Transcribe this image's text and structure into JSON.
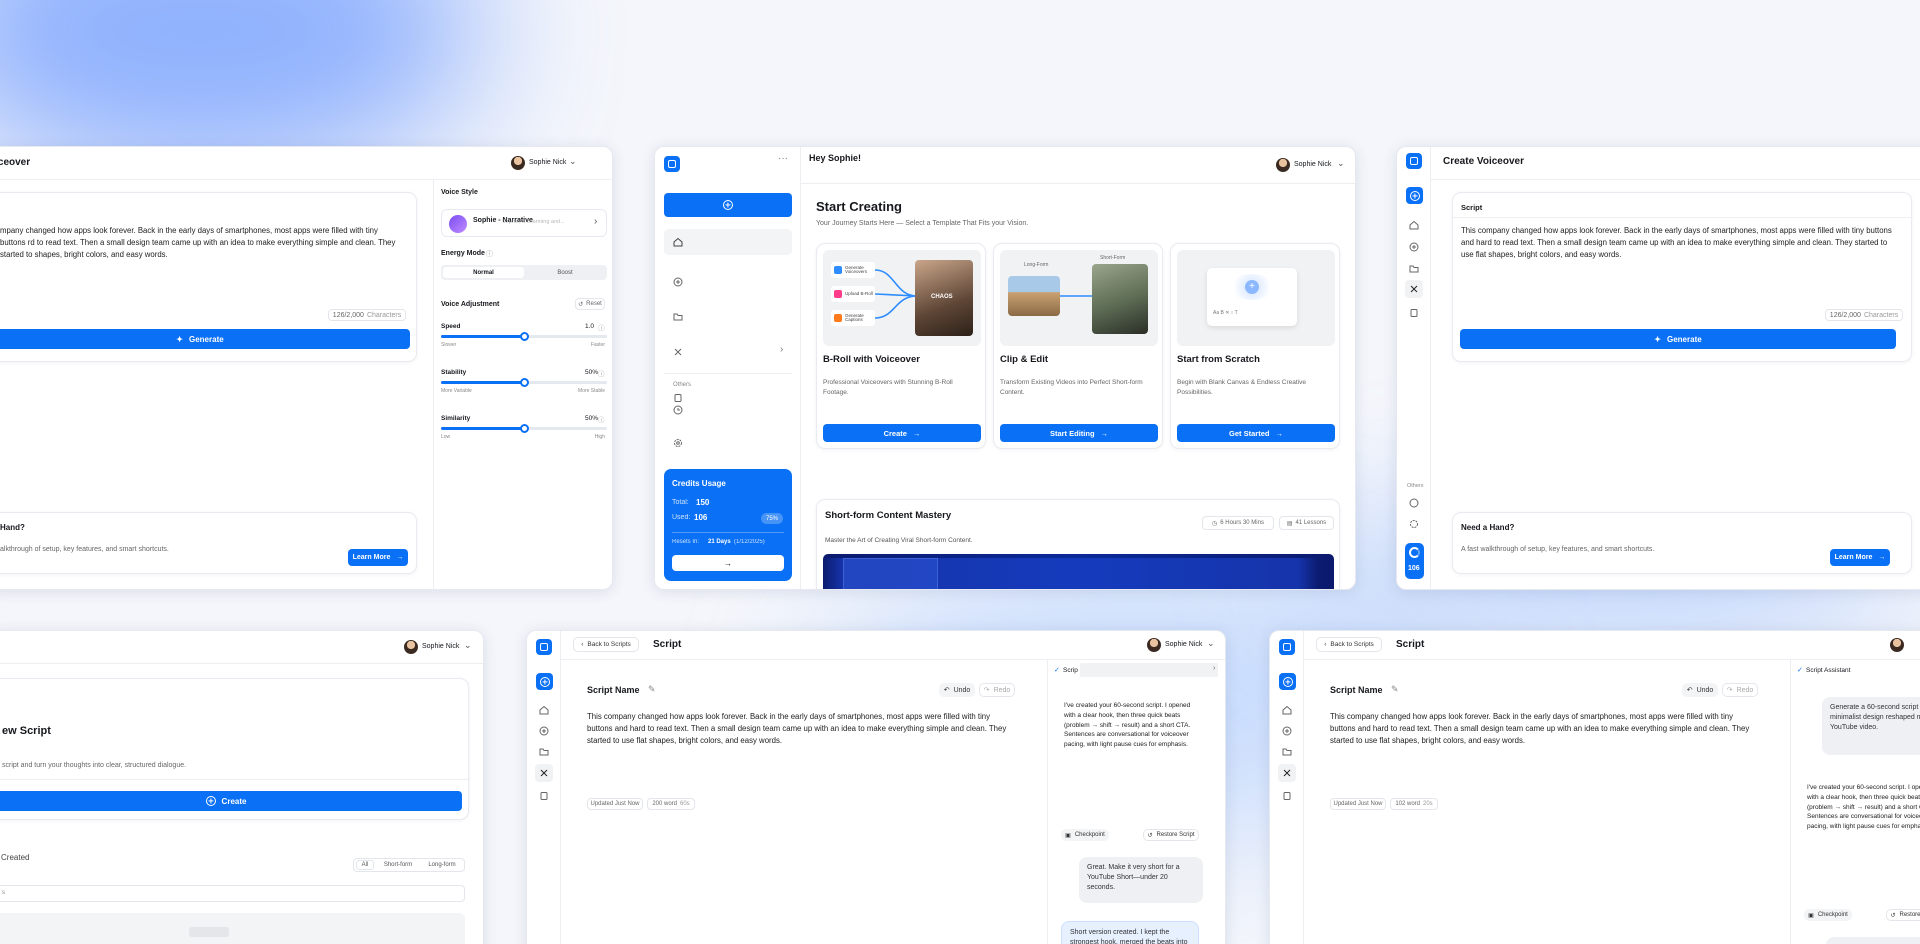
{
  "user": {
    "name": "Sophie Nick"
  },
  "colors": {
    "accent": "#0a70f5",
    "page_bg": "#f4f6fb",
    "credits_bg": "#0a70f5"
  },
  "script_text": "This company changed how apps look forever. Back in the early days of smartphones, most apps were filled with tiny buttons and hard to read text. Then a small design team came up with an idea to make everything simple and clean. They started to use flat shapes, bright colors, and easy words.",
  "script_text_cut": "mpany changed how apps look forever. Back in the early days of smartphones, most apps were filled with tiny buttons rd to read text. Then a small design team came up with an idea to make everything simple and clean. They started to shapes, bright colors, and easy words.",
  "voiceover_left": {
    "title": "oiceover",
    "char_count": "126/2,000",
    "char_unit": "Characters",
    "generate_label": "Generate",
    "help_title": "Hand?",
    "help_text": "alkthrough of setup, key features, and smart shortcuts.",
    "learn_more": "Learn More",
    "voice_style_label": "Voice Style",
    "voice_name": "Sophie - Narrative",
    "voice_desc": "Sophie, a charming and...",
    "energy_label": "Energy Mode",
    "energy_options": [
      "Normal",
      "Boost"
    ],
    "adjust_label": "Voice Adjustment",
    "reset_label": "Reset",
    "sliders": [
      {
        "label": "Speed",
        "value": "1.0",
        "fraction": 0.5,
        "low": "Slower",
        "high": "Faster"
      },
      {
        "label": "Stability",
        "value": "50%",
        "fraction": 0.5,
        "low": "More Variable",
        "high": "More Stable"
      },
      {
        "label": "Similarity",
        "value": "50%",
        "fraction": 0.5,
        "low": "Low",
        "high": "High"
      }
    ]
  },
  "dashboard": {
    "greeting": "Hey Sophie!",
    "nav_others": "Others",
    "credits": {
      "title": "Credits Usage",
      "total_label": "Total:",
      "total": "150",
      "used_label": "Used:",
      "used": "106",
      "percent": "75%",
      "resets_label": "Resets In:",
      "resets_value": "21 Days",
      "resets_date": "(1/12/2025)"
    },
    "heading": "Start Creating",
    "subheading": "Your Journey Starts Here — Select a Template That Fits your Vision.",
    "templates": [
      {
        "title": "B-Roll with Voiceover",
        "desc": "Professional Voiceovers with Stunning B-Roll Footage.",
        "cta": "Create",
        "chips": [
          "Generate Voiceovers",
          "Upload B-Roll",
          "Generate Captions"
        ],
        "thumb_caption": "CHAOS"
      },
      {
        "title": "Clip & Edit",
        "desc": "Transform Existing Videos into Perfect Short-form Content.",
        "cta": "Start Editing",
        "tags": [
          "Long-Form",
          "Short-Form"
        ]
      },
      {
        "title": "Start from Scratch",
        "desc": "Begin with Blank Canvas & Endless Creative Possibilities.",
        "cta": "Get Started",
        "toolbar": "Aa  B  ✕  ↕  T"
      }
    ],
    "course": {
      "title": "Short-form Content Mastery",
      "desc": "Master the Art of Creating Viral Short-form Content.",
      "duration": "6 Hours 30 Mins",
      "lessons": "41 Lessons"
    }
  },
  "create_voiceover": {
    "title": "Create Voiceover",
    "script_label": "Script",
    "char_count": "126/2,000",
    "char_unit": "Characters",
    "generate_label": "Generate",
    "others": "Others",
    "credit_count": "106",
    "help_title": "Need a Hand?",
    "help_text": "A fast walkthrough of setup, key features, and smart shortcuts.",
    "learn_more": "Learn More"
  },
  "new_script": {
    "title": "ew Script",
    "desc": "script and turn your thoughts into clear, structured dialogue.",
    "create_label": "Create",
    "section": "Created",
    "filters": [
      "All",
      "Short-form",
      "Long-form"
    ],
    "search_placeholder": "s"
  },
  "script_editor": {
    "back_label": "Back to Scripts",
    "title": "Script",
    "name_label": "Script Name",
    "undo": "Undo",
    "redo": "Redo",
    "updated": "Updated Just Now",
    "words_a": "200 word",
    "time_a": "60s",
    "words_b": "102 word",
    "time_b": "20s",
    "assistant": "Script Assistant",
    "assistant_cut": "Scrip",
    "msg_ai_1": "I've created your 60-second script. I opened with a clear hook, then three quick beats (problem → shift → result) and a short CTA. Sentences are conversational for voiceover pacing, with light pause cues for emphasis.",
    "checkpoint": "Checkpoint",
    "restore": "Restore Script",
    "msg_user_1": "Great. Make it very short for a YouTube Short—under 20 seconds.",
    "msg_ai_2": "Short version created. I kept the strongest hook, merged the beats into punchy one-",
    "msg_user_0": "Generate a 60-second script a minimalist design reshaped mo for a YouTube video."
  }
}
